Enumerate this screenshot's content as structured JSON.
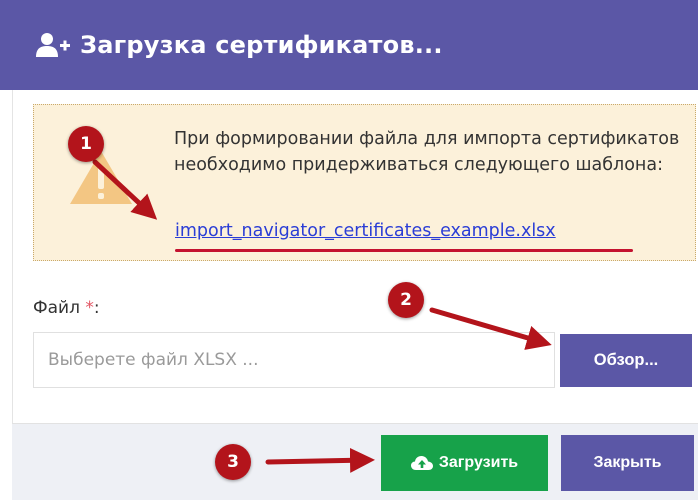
{
  "header": {
    "title": "Загрузка сертификатов...",
    "icon": "user-plus-icon",
    "background": "#5b57a6"
  },
  "alert": {
    "text": "При формировании файла для импорта сертификатов необходимо придерживаться следующего шаблона:",
    "link": "import_navigator_certificates_example.xlsx",
    "icon": "warning-icon"
  },
  "form": {
    "file_label": "Файл",
    "required_mark": "*",
    "label_suffix": ":",
    "file_placeholder": "Выберете файл XLSX ...",
    "browse_label": "Обзор..."
  },
  "footer": {
    "upload_label": "Загрузить",
    "upload_icon": "cloud-upload-icon",
    "close_label": "Закрыть"
  },
  "annotations": {
    "markers": [
      "1",
      "2",
      "3"
    ],
    "color": "#b3141b"
  },
  "colors": {
    "primary": "#5b57a6",
    "success": "#17a24a",
    "alert_bg": "#fcf1da",
    "link": "#2a3dd6"
  }
}
